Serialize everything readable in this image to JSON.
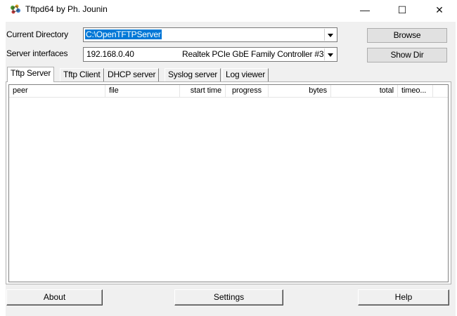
{
  "window": {
    "title": "Tftpd64 by Ph. Jounin",
    "minimize_glyph": "—",
    "maximize_glyph": "☐",
    "close_glyph": "✕"
  },
  "settings": {
    "current_directory_label": "Current Directory",
    "current_directory_value": "C:\\OpenTFTPServer",
    "server_interfaces_label": "Server interfaces",
    "server_interface_ip": "192.168.0.40",
    "server_interface_adapter": "Realtek PCIe GbE Family Controller #3",
    "browse_label": "Browse",
    "show_dir_label": "Show Dir"
  },
  "tabs": [
    {
      "label": "Tftp Server",
      "active": true
    },
    {
      "label": "Tftp Client",
      "active": false
    },
    {
      "label": "DHCP server",
      "active": false
    },
    {
      "label": "Syslog server",
      "active": false
    },
    {
      "label": "Log viewer",
      "active": false
    }
  ],
  "table": {
    "columns": [
      "peer",
      "file",
      "start time",
      "progress",
      "bytes",
      "total",
      "timeo..."
    ],
    "rows": []
  },
  "bottom_buttons": {
    "about": "About",
    "settings": "Settings",
    "help": "Help"
  },
  "colors": {
    "selection": "#0078d7",
    "client_bg": "#f0f0f0"
  },
  "icons": {
    "app": "tftpd-app-icon",
    "dropdown": "chevron-down-icon"
  }
}
